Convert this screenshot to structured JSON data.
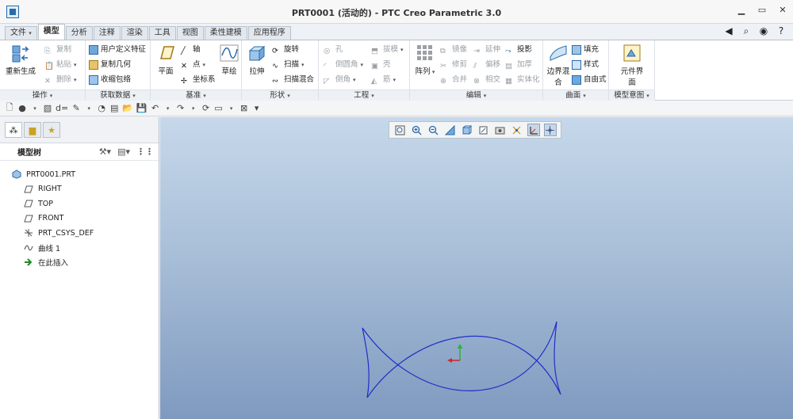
{
  "window": {
    "title": "PRT0001 (活动的) - PTC Creo Parametric 3.0"
  },
  "tabs": [
    {
      "label": "文件",
      "dropdown": true
    },
    {
      "label": "模型",
      "active": true
    },
    {
      "label": "分析"
    },
    {
      "label": "注释"
    },
    {
      "label": "渲染"
    },
    {
      "label": "工具"
    },
    {
      "label": "视图"
    },
    {
      "label": "柔性建模"
    },
    {
      "label": "应用程序"
    }
  ],
  "ribbon": {
    "operations": {
      "label": "操作",
      "regenerate": "重新生成",
      "copy": "复制",
      "paste": "粘贴",
      "delete": "删除"
    },
    "get_data": {
      "label": "获取数据",
      "udf": "用户定义特征",
      "copy_geom": "复制几何",
      "shrinkwrap": "收缩包络"
    },
    "datum": {
      "label": "基准",
      "plane": "平面",
      "axis": "轴",
      "point": "点",
      "csys": "坐标系",
      "sketch": "草绘"
    },
    "shapes": {
      "label": "形状",
      "extrude": "拉伸",
      "revolve": "旋转",
      "sweep": "扫描",
      "swept_blend": "扫描混合"
    },
    "engineering": {
      "label": "工程",
      "hole": "孔",
      "round": "倒圆角",
      "chamfer": "倒角",
      "draft": "拔模",
      "shell": "壳",
      "rib": "筋"
    },
    "editing": {
      "label": "编辑",
      "pattern": "阵列",
      "mirror": "镜像",
      "trim": "修剪",
      "merge": "合并",
      "extend": "延伸",
      "offset": "偏移",
      "intersect": "相交",
      "project": "投影",
      "thicken": "加厚",
      "solidify": "实体化"
    },
    "surfaces": {
      "label": "曲面",
      "boundary_blend": "边界混合",
      "fill": "填充",
      "style": "样式",
      "freestyle": "自由式"
    },
    "model_intent": {
      "label": "模型意图",
      "component_interface": "元件界面"
    }
  },
  "model_tree": {
    "title": "模型树",
    "items": [
      {
        "label": "PRT0001.PRT",
        "icon": "part-icon"
      },
      {
        "label": "RIGHT",
        "icon": "datum-plane-icon"
      },
      {
        "label": "TOP",
        "icon": "datum-plane-icon"
      },
      {
        "label": "FRONT",
        "icon": "datum-plane-icon"
      },
      {
        "label": "PRT_CSYS_DEF",
        "icon": "csys-icon"
      },
      {
        "label": "曲线 1",
        "icon": "curve-icon"
      },
      {
        "label": "在此插入",
        "icon": "insert-arrow-icon"
      }
    ]
  },
  "colors": {
    "curve": "#1f2fc8",
    "axis_y": "#2fb43a",
    "axis_x": "#d02a2a",
    "accent": "#2a6aa8"
  }
}
